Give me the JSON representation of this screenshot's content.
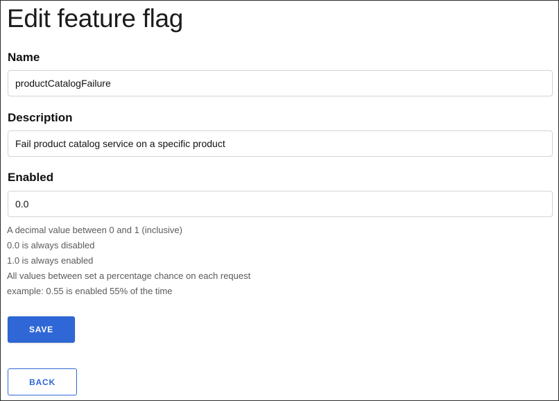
{
  "page": {
    "title": "Edit feature flag"
  },
  "form": {
    "name": {
      "label": "Name",
      "value": "productCatalogFailure"
    },
    "description": {
      "label": "Description",
      "value": "Fail product catalog service on a specific product"
    },
    "enabled": {
      "label": "Enabled",
      "value": "0.0",
      "help": [
        "A decimal value between 0 and 1 (inclusive)",
        "0.0 is always disabled",
        "1.0 is always enabled",
        "All values between set a percentage chance on each request",
        "example: 0.55 is enabled 55% of the time"
      ]
    }
  },
  "actions": {
    "save_label": "SAVE",
    "back_label": "BACK"
  },
  "colors": {
    "primary": "#2f67d6",
    "input_border": "#d3d3d3",
    "help_text": "#5a5a5a"
  }
}
